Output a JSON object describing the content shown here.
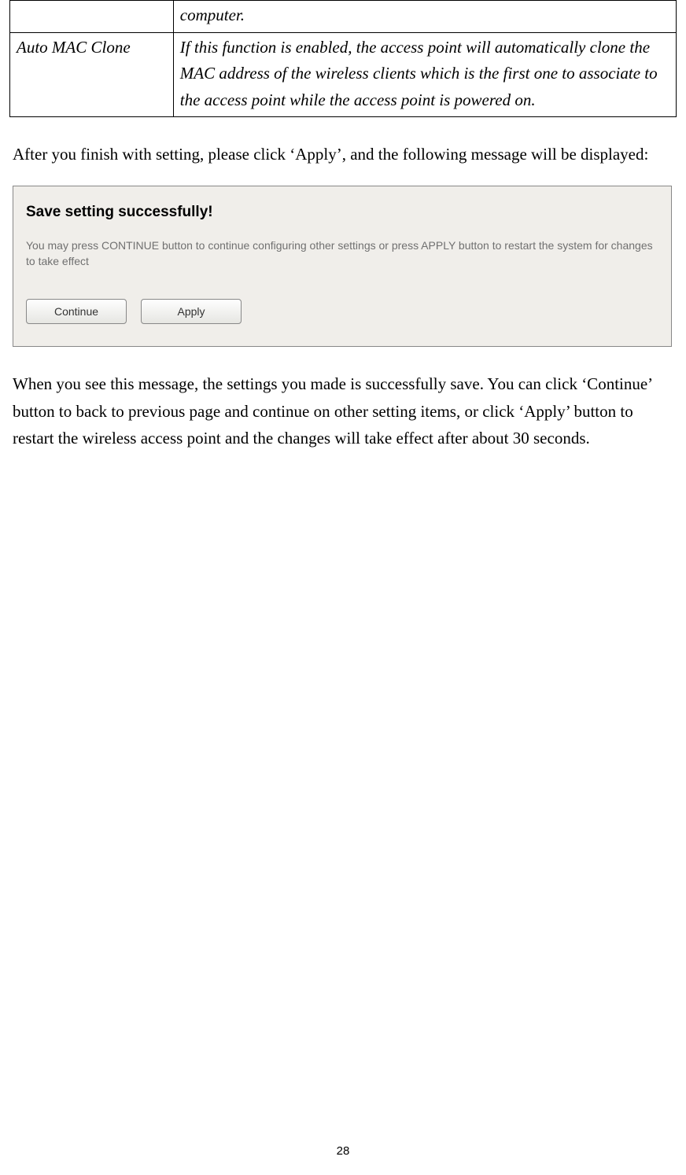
{
  "table": {
    "row0": {
      "left": "",
      "right": "computer."
    },
    "row1": {
      "left": "Auto MAC Clone",
      "right": "If this function is enabled, the access point will automatically clone the MAC address of the wireless clients which is the first one to associate to the access point while the access point is powered on."
    }
  },
  "para1": "After you finish with setting, please click ‘Apply’, and the following message will be displayed:",
  "screenshot": {
    "title": "Save setting successfully!",
    "body": "You may press CONTINUE button to continue configuring other settings or press APPLY button to restart the system for changes to take effect",
    "continue": "Continue",
    "apply": "Apply"
  },
  "para2": "When you see this message, the settings you made is successfully save. You can click ‘Continue’ button to back to previous page and continue on other setting items, or click ‘Apply’ button to restart the wireless access point and the changes will take effect after about 30 seconds.",
  "page": "28"
}
